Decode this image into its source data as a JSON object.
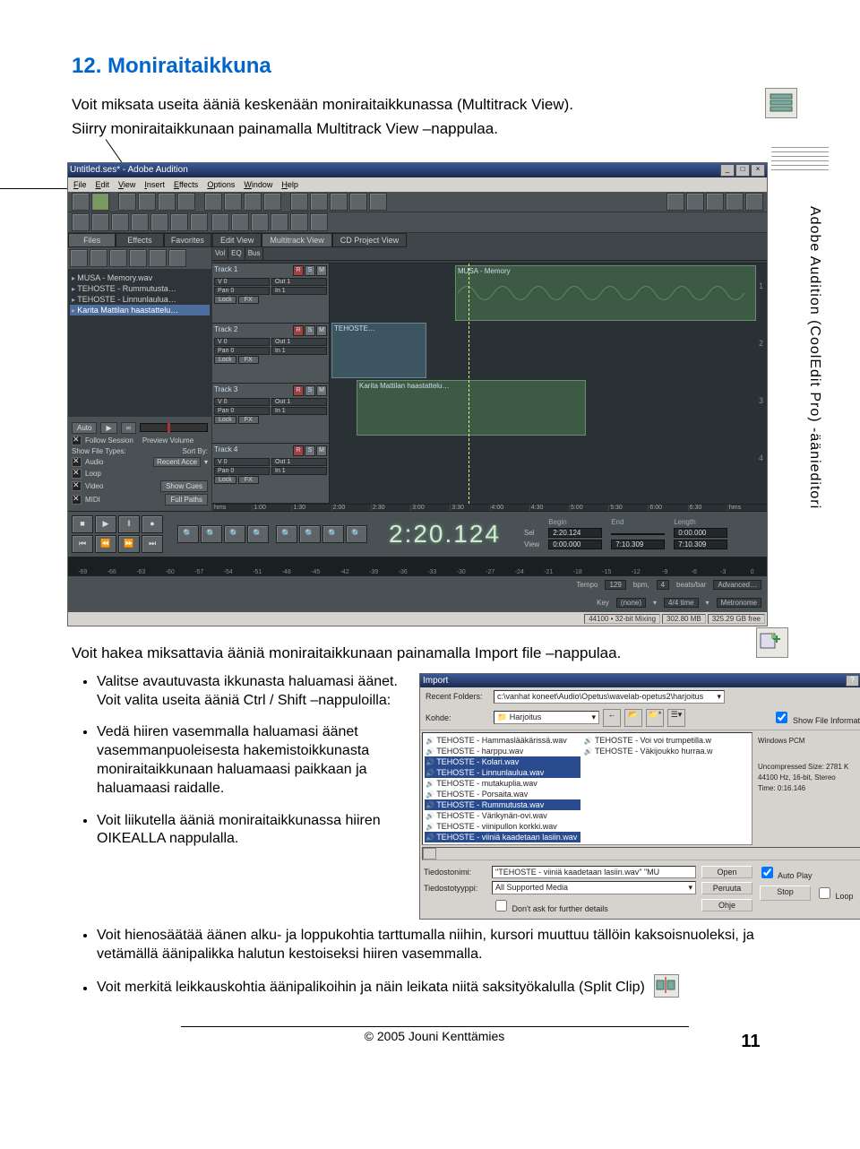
{
  "heading": "12. Moniraitaikkuna",
  "intro_line1": "Voit miksata useita ääniä keskenään moniraitaikkunassa (Multitrack View).",
  "intro_line2": "Siirry moniraitaikkunaan painamalla Multitrack View –nappulaa.",
  "side_text": "Adobe Audition (CoolEdit Pro) -äänieditori",
  "app": {
    "title": "Untitled.ses* - Adobe Audition",
    "menu": [
      "File",
      "Edit",
      "View",
      "Insert",
      "Effects",
      "Options",
      "Window",
      "Help"
    ],
    "sidebar_tabs": [
      "Files",
      "Effects",
      "Favorites"
    ],
    "files": [
      "MUSA - Memory.wav",
      "TEHOSTE - Rummutusta…",
      "TEHOSTE - Linnunlaulua…",
      "Karita Mattilan haastattelu…"
    ],
    "auto_label": "Auto",
    "follow_session": "Follow Session",
    "preview_volume": "Preview Volume",
    "show_file_types": "Show File Types:",
    "sort_by": "Sort By:",
    "ft_audio": "Audio",
    "ft_loop": "Loop",
    "ft_video": "Video",
    "ft_midi": "MIDI",
    "sort_recent": "Recent Acce",
    "show_cues": "Show Cues",
    "full_paths": "Full Paths",
    "view_tabs": [
      "Edit View",
      "Multitrack View",
      "CD Project View"
    ],
    "th": [
      "Vol",
      "EQ",
      "Bus"
    ],
    "tracks": [
      {
        "name": "Track 1",
        "clip": "MUSA - Memory"
      },
      {
        "name": "Track 2",
        "clip": "TEHOSTE…"
      },
      {
        "name": "Track 3",
        "clip": "Karita Mattilan haastattelu…"
      },
      {
        "name": "Track 4",
        "clip": ""
      }
    ],
    "tc_v0": "V 0",
    "tc_out1": "Out 1",
    "tc_pan0": "Pan 0",
    "tc_in1": "In 1",
    "tc_lock": "Lock",
    "tc_fx": "FX",
    "ruler_hms_l": "hms",
    "ruler_marks": [
      "1:00",
      "1:30",
      "2:00",
      "2:30",
      "3:00",
      "3:30",
      "4:00",
      "4:30",
      "5:00",
      "5:30",
      "6:00",
      "6:30"
    ],
    "ruler_hms_r": "hms",
    "timecode": "2:20.124",
    "sel": {
      "hdr_begin": "Begin",
      "hdr_end": "End",
      "hdr_length": "Length",
      "sel_label": "Sel",
      "view_label": "View",
      "sel_begin": "2:20.124",
      "sel_end": "",
      "sel_len": "0:00.000",
      "view_begin": "0:00.000",
      "view_end": "7:10.309",
      "view_len": "7:10.309"
    },
    "tempo_label": "Tempo",
    "tempo_val": "129",
    "bpm": "bpm,",
    "beats_val": "4",
    "beats_bar": "beats/bar",
    "advanced": "Advanced…",
    "key_label": "Key",
    "key_val": "(none)",
    "time_sig": "4/4 time",
    "metronome": "Metronome",
    "meter_marks": [
      "-69",
      "-66",
      "-63",
      "-60",
      "-57",
      "-54",
      "-51",
      "-48",
      "-45",
      "-42",
      "-39",
      "-36",
      "-33",
      "-30",
      "-27",
      "-24",
      "-21",
      "-18",
      "-15",
      "-12",
      "-9",
      "-6",
      "-3",
      "0"
    ],
    "status": [
      "44100 • 32-bit Mixing",
      "302.80 MB",
      "325.29 GB free"
    ]
  },
  "lead2": "Voit hakea miksattavia ääniä moniraitaikkunaan painamalla Import file –nappulaa.",
  "bullets_left": [
    "Valitse avautuvasta ikkunasta haluamasi äänet. Voit valita useita ääniä Ctrl / Shift –nappuloilla:",
    "Vedä hiiren vasemmalla haluamasi äänet vasemmanpuoleisesta hakemistoikkunasta moniraitaikkunaan haluamaasi paikkaan ja haluamaasi raidalle.",
    "Voit liikutella ääniä moniraitaikkunassa hiiren OIKEALLA nappulalla."
  ],
  "dialog": {
    "title": "Import",
    "recent_label": "Recent Folders:",
    "recent_val": "c:\\vanhat koneet\\Audio\\Opetus\\wavelab-opetus2\\harjoitus",
    "kohde_label": "Kohde:",
    "kohde_val": "Harjoitus",
    "show_info": "Show File Information",
    "col1": [
      "TEHOSTE - Hammaslääkärissä.wav",
      "TEHOSTE - harppu.wav",
      "TEHOSTE - Kolari.wav",
      "TEHOSTE - Linnunlaulua.wav",
      "TEHOSTE - mutakuplia.wav",
      "TEHOSTE - Porsaita.wav",
      "TEHOSTE - Rummutusta.wav",
      "TEHOSTE - Värikynän-ovi.wav",
      "TEHOSTE - viinipullon korkki.wav",
      "TEHOSTE - viiniä kaadetaan lasiin.wav"
    ],
    "col2": [
      "TEHOSTE - Voi voi trumpetilla.w",
      "TEHOSTE - Väkijoukko hurraa.w"
    ],
    "side_windows": "Windows PCM",
    "side_unc": "Uncompressed Size: 2781 K",
    "side_rate": "44100 Hz, 16-bit, Stereo",
    "side_time": "Time: 0:16.146",
    "fname_label": "Tiedostonimi:",
    "fname_val": "\"TEHOSTE - viiniä kaadetaan lasiin.wav\" \"MU",
    "ftype_label": "Tiedostotyyppi:",
    "ftype_val": "All Supported Media",
    "dont_ask": "Don't ask for further details",
    "btn_open": "Open",
    "btn_cancel": "Peruuta",
    "btn_help": "Ohje",
    "auto_play": "Auto Play",
    "btn_stop": "Stop",
    "loop": "Loop"
  },
  "bullets_full": [
    "Voit hienosäätää äänen alku- ja loppukohtia tarttumalla niihin, kursori muuttuu tällöin kaksoisnuoleksi, ja vetämällä äänipalikka halutun kestoiseksi hiiren vasemmalla.",
    "Voit merkitä leikkauskohtia äänipalikoihin ja näin leikata niitä saksityökalulla (Split Clip)"
  ],
  "footer": "© 2005 Jouni Kenttämies",
  "page_num": "11"
}
